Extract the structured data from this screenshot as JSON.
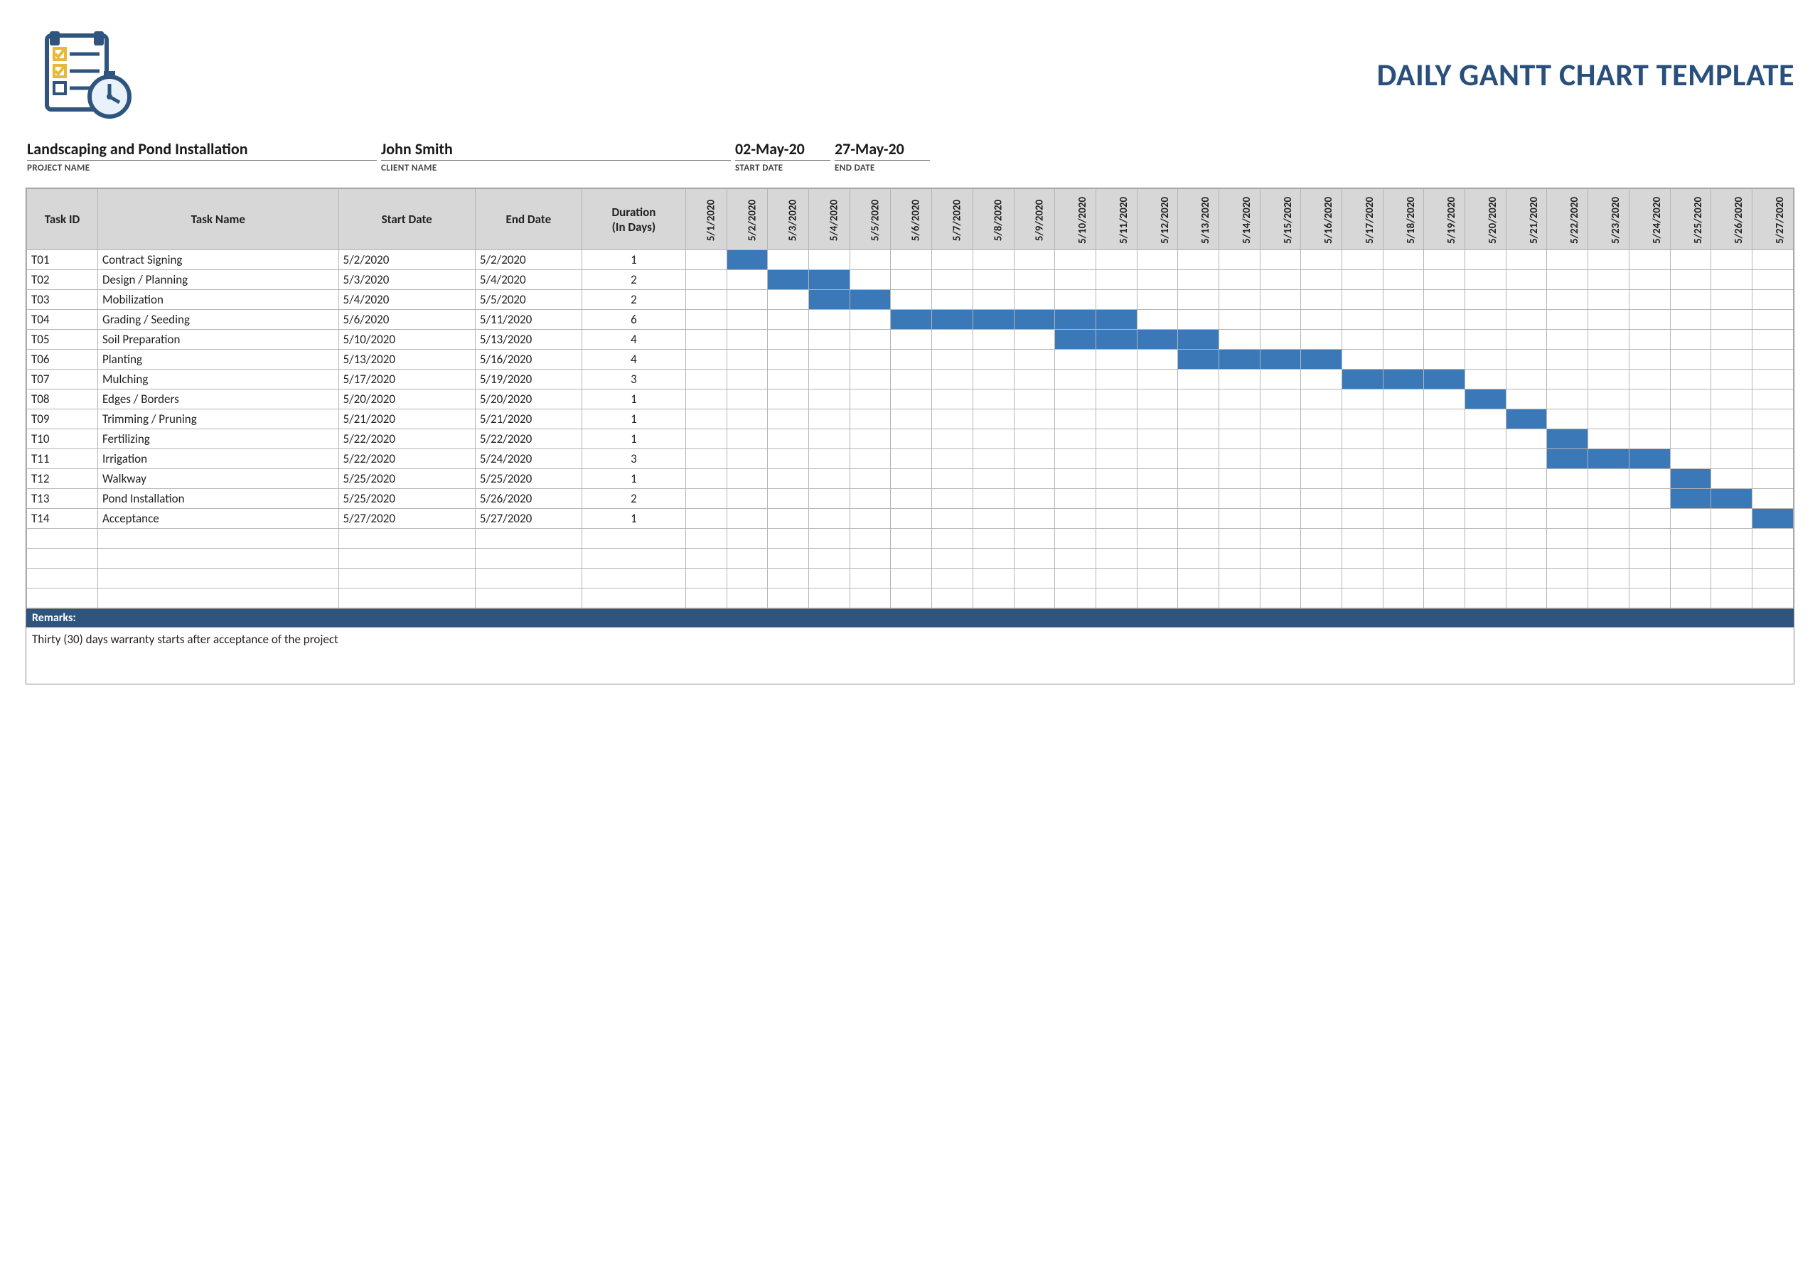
{
  "title": "DAILY GANTT CHART TEMPLATE",
  "meta": {
    "project_name": {
      "value": "Landscaping and Pond Installation",
      "label": "PROJECT NAME"
    },
    "client_name": {
      "value": "John Smith",
      "label": "CLIENT NAME"
    },
    "start_date": {
      "value": "02-May-20",
      "label": "START DATE"
    },
    "end_date": {
      "value": "27-May-20",
      "label": "END DATE"
    }
  },
  "columns": {
    "task_id": "Task ID",
    "task_name": "Task Name",
    "start": "Start Date",
    "end": "End Date",
    "duration": "Duration (In Days)"
  },
  "remarks": {
    "heading": "Remarks:",
    "body": "Thirty (30) days warranty starts after acceptance of the project"
  },
  "chart_data": {
    "type": "bar",
    "title": "DAILY GANTT CHART TEMPLATE",
    "xlabel": "",
    "ylabel": "",
    "x_dates": [
      "5/1/2020",
      "5/2/2020",
      "5/3/2020",
      "5/4/2020",
      "5/5/2020",
      "5/6/2020",
      "5/7/2020",
      "5/8/2020",
      "5/9/2020",
      "5/10/2020",
      "5/11/2020",
      "5/12/2020",
      "5/13/2020",
      "5/14/2020",
      "5/15/2020",
      "5/16/2020",
      "5/17/2020",
      "5/18/2020",
      "5/19/2020",
      "5/20/2020",
      "5/21/2020",
      "5/22/2020",
      "5/23/2020",
      "5/24/2020",
      "5/25/2020",
      "5/26/2020",
      "5/27/2020"
    ],
    "tasks": [
      {
        "id": "T01",
        "name": "Contract Signing",
        "start": "5/2/2020",
        "end": "5/2/2020",
        "duration": 1
      },
      {
        "id": "T02",
        "name": "Design / Planning",
        "start": "5/3/2020",
        "end": "5/4/2020",
        "duration": 2
      },
      {
        "id": "T03",
        "name": "Mobilization",
        "start": "5/4/2020",
        "end": "5/5/2020",
        "duration": 2
      },
      {
        "id": "T04",
        "name": "Grading / Seeding",
        "start": "5/6/2020",
        "end": "5/11/2020",
        "duration": 6
      },
      {
        "id": "T05",
        "name": "Soil Preparation",
        "start": "5/10/2020",
        "end": "5/13/2020",
        "duration": 4
      },
      {
        "id": "T06",
        "name": "Planting",
        "start": "5/13/2020",
        "end": "5/16/2020",
        "duration": 4
      },
      {
        "id": "T07",
        "name": "Mulching",
        "start": "5/17/2020",
        "end": "5/19/2020",
        "duration": 3
      },
      {
        "id": "T08",
        "name": "Edges / Borders",
        "start": "5/20/2020",
        "end": "5/20/2020",
        "duration": 1
      },
      {
        "id": "T09",
        "name": "Trimming / Pruning",
        "start": "5/21/2020",
        "end": "5/21/2020",
        "duration": 1
      },
      {
        "id": "T10",
        "name": "Fertilizing",
        "start": "5/22/2020",
        "end": "5/22/2020",
        "duration": 1
      },
      {
        "id": "T11",
        "name": "Irrigation",
        "start": "5/22/2020",
        "end": "5/24/2020",
        "duration": 3
      },
      {
        "id": "T12",
        "name": "Walkway",
        "start": "5/25/2020",
        "end": "5/25/2020",
        "duration": 1
      },
      {
        "id": "T13",
        "name": "Pond Installation",
        "start": "5/25/2020",
        "end": "5/26/2020",
        "duration": 2
      },
      {
        "id": "T14",
        "name": "Acceptance",
        "start": "5/27/2020",
        "end": "5/27/2020",
        "duration": 1
      }
    ],
    "empty_rows": 4
  }
}
